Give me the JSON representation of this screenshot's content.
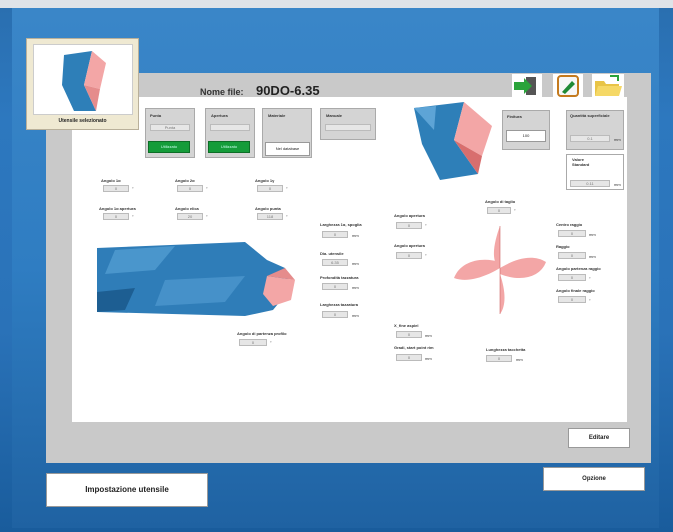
{
  "header": {
    "file_label": "Nome file:",
    "file_name": "90DO-6.35"
  },
  "selected_tool_label": "Utensile selezionato",
  "top_groups": {
    "punta": {
      "title": "Punta",
      "value": "Punta",
      "button": "Utilizzato"
    },
    "apertura": {
      "title": "Apertura",
      "value": "",
      "button": "Utilizzato"
    },
    "materiale": {
      "title": "Materiale",
      "button": "Nel database"
    },
    "manuale": {
      "title": "Manuale",
      "value": ""
    }
  },
  "right_fields": {
    "finitura": {
      "title": "Finitura",
      "value": "100"
    },
    "quantita": {
      "title": "Quantità superficiale",
      "value": "0.1",
      "unit": "mm"
    },
    "valore": {
      "title": "Valore Standard",
      "value": "0.11",
      "unit": "mm"
    }
  },
  "angles_row1": [
    {
      "label": "Angolo 1α",
      "value": "0",
      "unit": "°"
    },
    {
      "label": "Angolo 2α",
      "value": "0",
      "unit": "°"
    },
    {
      "label": "Angolo 1γ",
      "value": "0",
      "unit": "°"
    }
  ],
  "angles_row2": [
    {
      "label": "Angolo 1α apertura",
      "value": "0",
      "unit": "°"
    },
    {
      "label": "Angolo elica",
      "value": "20",
      "unit": "°"
    },
    {
      "label": "Angolo punta",
      "value": "118",
      "unit": "°"
    }
  ],
  "mid_fields": [
    {
      "label": "Larghezza 1α, spoglia",
      "value": "0",
      "unit": "mm"
    },
    {
      "label": "Dia. utensile",
      "value": "6.35",
      "unit": "mm"
    },
    {
      "label": "Profondità tazzatura",
      "value": "0",
      "unit": "mm"
    },
    {
      "label": "Larghezza tazzatura",
      "value": "0",
      "unit": "mm"
    }
  ],
  "aperture_fields": [
    {
      "label": "Angolo apertura",
      "value": "0",
      "unit": "°"
    },
    {
      "label": "Angolo apertura",
      "value": "0",
      "unit": "°"
    }
  ],
  "taglio": {
    "label": "Angolo di taglio",
    "value": "0",
    "unit": "°"
  },
  "right_side_fields": [
    {
      "label": "Centro raggio",
      "value": "0",
      "unit": "mm"
    },
    {
      "label": "Raggio",
      "value": "0",
      "unit": "mm"
    },
    {
      "label": "Angolo partenza raggio",
      "value": "0",
      "unit": "°"
    },
    {
      "label": "Angolo finale raggio",
      "value": "0",
      "unit": "°"
    }
  ],
  "bottom_fields": {
    "angolo_partenza": {
      "label": "Angolo di partenza profilo",
      "value": "0",
      "unit": "°"
    },
    "x_fine": {
      "label": "X_fine aspiel",
      "value": "0",
      "unit": "mm"
    },
    "gradi": {
      "label": "Gradi, start point rim",
      "value": "0",
      "unit": "mm"
    },
    "lunghezza": {
      "label": "Lunghezza tacchetta",
      "value": "0",
      "unit": "mm"
    }
  },
  "buttons": {
    "edit": "Editare",
    "options": "Opzione",
    "setup": "Impostazione utensile"
  }
}
